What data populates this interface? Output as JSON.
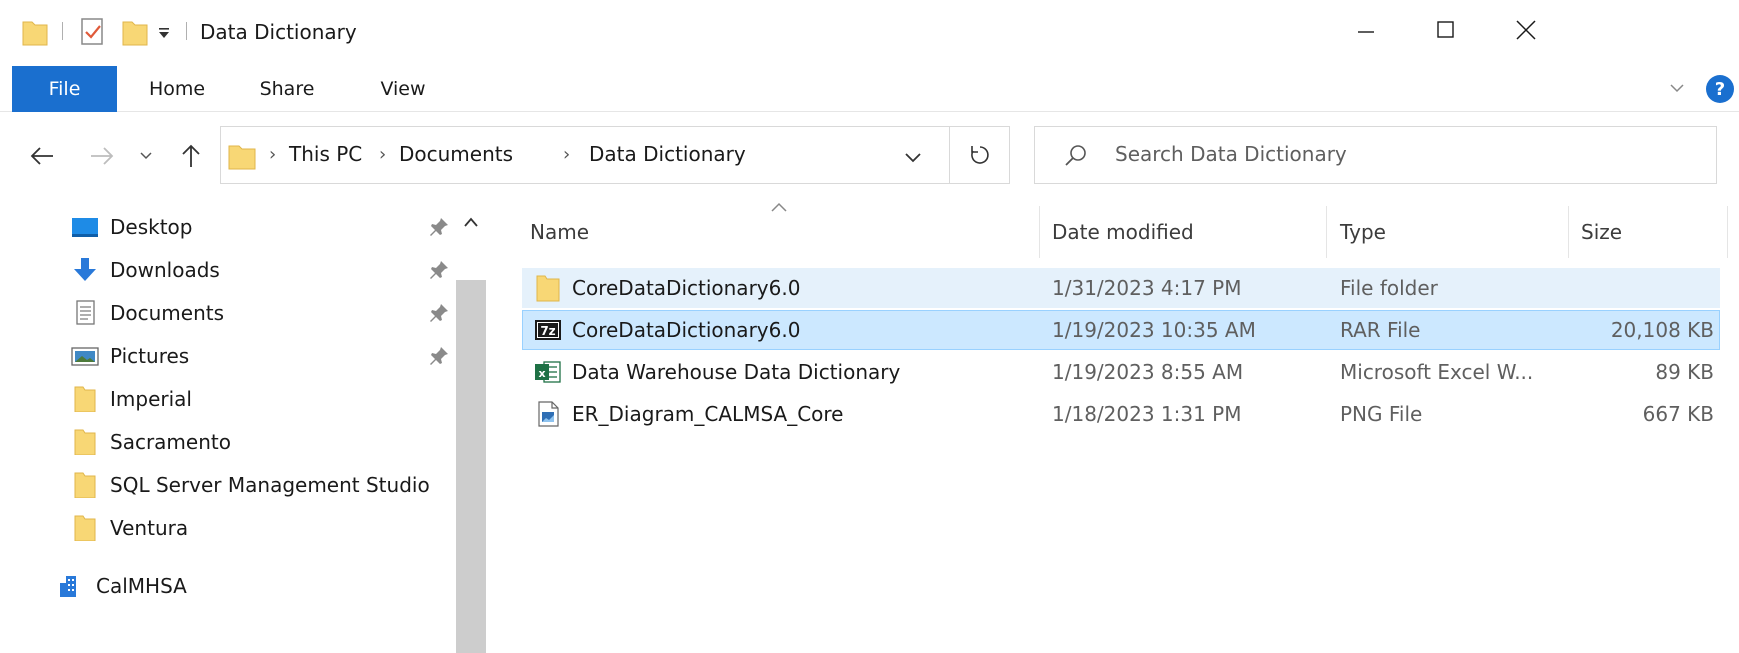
{
  "window": {
    "title": "Data Dictionary",
    "minimize_glyph": "—",
    "maximize_glyph": "☐",
    "close_glyph": "✕"
  },
  "ribbon": {
    "tabs": [
      "File",
      "Home",
      "Share",
      "View"
    ],
    "help_glyph": "?"
  },
  "address": {
    "crumbs": [
      "This PC",
      "Documents",
      "Data Dictionary"
    ],
    "separator": "›"
  },
  "search": {
    "placeholder": "Search Data Dictionary"
  },
  "nav_pane": {
    "items": [
      {
        "label": "Desktop",
        "icon": "desktop-icon",
        "pinned": true
      },
      {
        "label": "Downloads",
        "icon": "downloads-icon",
        "pinned": true
      },
      {
        "label": "Documents",
        "icon": "documents-icon",
        "pinned": true
      },
      {
        "label": "Pictures",
        "icon": "pictures-icon",
        "pinned": true
      },
      {
        "label": "Imperial",
        "icon": "folder-icon",
        "pinned": false
      },
      {
        "label": "Sacramento",
        "icon": "folder-icon",
        "pinned": false
      },
      {
        "label": "SQL Server Management Studio",
        "icon": "folder-icon",
        "pinned": false
      },
      {
        "label": "Ventura",
        "icon": "folder-icon",
        "pinned": false
      },
      {
        "label": "CalMHSA",
        "icon": "organization-icon",
        "pinned": false
      }
    ]
  },
  "file_list": {
    "columns": [
      "Name",
      "Date modified",
      "Type",
      "Size"
    ],
    "rows": [
      {
        "name": "CoreDataDictionary6.0",
        "date": "1/31/2023 4:17 PM",
        "type": "File folder",
        "size": "",
        "icon": "folder-icon",
        "state": "hover"
      },
      {
        "name": "CoreDataDictionary6.0",
        "date": "1/19/2023 10:35 AM",
        "type": "RAR File",
        "size": "20,108 KB",
        "icon": "7zip-archive-icon",
        "state": "selected"
      },
      {
        "name": "Data Warehouse Data Dictionary",
        "date": "1/19/2023 8:55 AM",
        "type": "Microsoft Excel W...",
        "size": "89 KB",
        "icon": "excel-file-icon",
        "state": "none"
      },
      {
        "name": "ER_Diagram_CALMSA_Core",
        "date": "1/18/2023 1:31 PM",
        "type": "PNG File",
        "size": "667 KB",
        "icon": "png-image-icon",
        "state": "none"
      }
    ]
  },
  "colors": {
    "accent": "#1a6fcf",
    "folder": "#f8d775",
    "selection": "#cce8ff",
    "hover": "#e5f1fb"
  }
}
